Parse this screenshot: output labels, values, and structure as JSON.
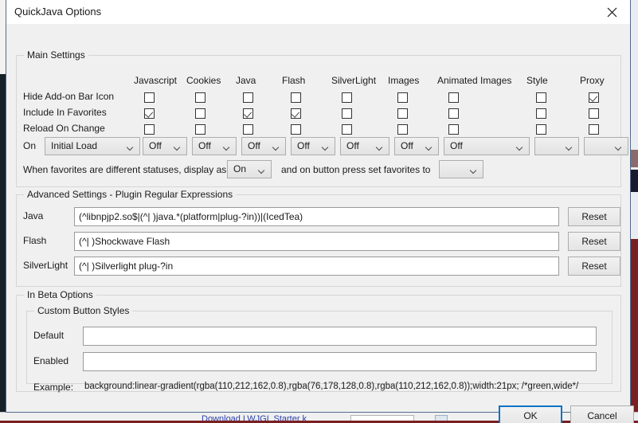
{
  "window": {
    "title": "QuickJava Options",
    "close_icon": "close-icon"
  },
  "main_settings": {
    "legend": "Main Settings",
    "columns": [
      "Javascript",
      "Cookies",
      "Java",
      "Flash",
      "SilverLight",
      "Images",
      "Animated Images",
      "Style",
      "Proxy"
    ],
    "rows": [
      {
        "label": "Hide Add-on Bar Icon",
        "checked": [
          false,
          false,
          false,
          false,
          false,
          false,
          false,
          false,
          true
        ]
      },
      {
        "label": "Include In Favorites",
        "checked": [
          true,
          false,
          true,
          true,
          false,
          false,
          false,
          false,
          false
        ]
      },
      {
        "label": "Reload On Change",
        "checked": [
          false,
          false,
          false,
          false,
          false,
          false,
          false,
          false,
          false
        ]
      }
    ],
    "on_row_label": "On",
    "on_values": [
      "Initial Load",
      "Off",
      "Off",
      "Off",
      "Off",
      "Off",
      "Off",
      "Off",
      "",
      ""
    ],
    "favorites_text_before": "When favorites are different statuses, display as",
    "favorites_display_value": "On",
    "favorites_text_after": "and on button press set favorites to",
    "favorites_set_value": ""
  },
  "advanced_settings": {
    "legend": "Advanced Settings - Plugin Regular Expressions",
    "rows": [
      {
        "label": "Java",
        "value": "(^libnpjp2.so$|(^| )java.*(platform|plug-?in))|(IcedTea)",
        "reset_label": "Reset"
      },
      {
        "label": "Flash",
        "value": "(^| )Shockwave Flash",
        "reset_label": "Reset"
      },
      {
        "label": "SilverLight",
        "value": "(^| )Silverlight plug-?in",
        "reset_label": "Reset"
      }
    ]
  },
  "beta_options": {
    "legend": "In Beta Options",
    "custom_button_styles": {
      "legend": "Custom Button Styles",
      "fields": [
        {
          "label": "Default",
          "value": ""
        },
        {
          "label": "Enabled",
          "value": ""
        }
      ],
      "example_label": "Example:",
      "example_value": "background:linear-gradient(rgba(110,212,162,0.8),rgba(76,178,128,0.8),rgba(110,212,162,0.8));width:21px; /*green,wide*/"
    }
  },
  "footer": {
    "ok_label": "OK",
    "cancel_label": "Cancel"
  },
  "background": {
    "partial_link_text": "Download LWJGL Starter k"
  }
}
